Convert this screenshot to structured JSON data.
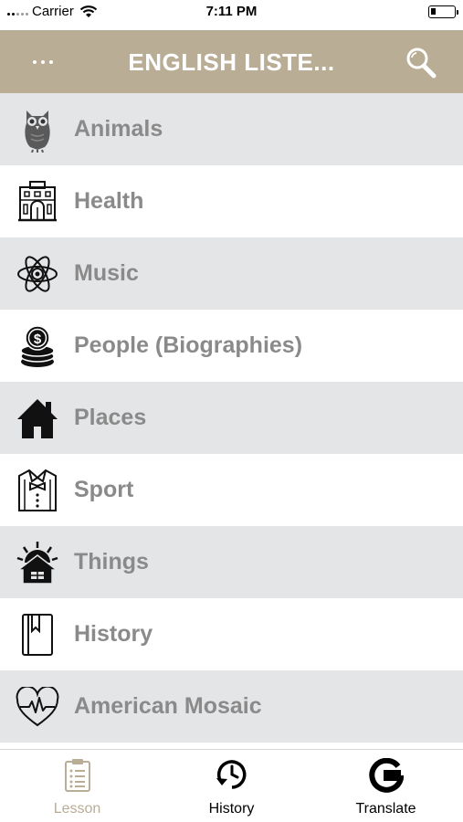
{
  "status_bar": {
    "carrier": "Carrier",
    "time": "7:11 PM"
  },
  "nav": {
    "title": "ENGLISH LISTE...",
    "menu_icon": "more-dots-icon",
    "search_icon": "search-icon",
    "background_color": "#b9ad95"
  },
  "categories": [
    {
      "label": "Animals",
      "icon": "owl-icon"
    },
    {
      "label": "Health",
      "icon": "building-icon"
    },
    {
      "label": "Music",
      "icon": "atom-icon"
    },
    {
      "label": "People (Biographies)",
      "icon": "coins-icon"
    },
    {
      "label": "Places",
      "icon": "house-icon"
    },
    {
      "label": "Sport",
      "icon": "shirt-bowtie-icon"
    },
    {
      "label": "Things",
      "icon": "sunrise-house-icon"
    },
    {
      "label": "History",
      "icon": "book-icon"
    },
    {
      "label": "American Mosaic",
      "icon": "heart-pulse-icon"
    }
  ],
  "tabs": [
    {
      "label": "Lesson",
      "icon": "clipboard-icon",
      "active": true
    },
    {
      "label": "History",
      "icon": "clock-history-icon",
      "active": false
    },
    {
      "label": "Translate",
      "icon": "google-g-icon",
      "active": false
    }
  ],
  "colors": {
    "accent": "#b9ad95",
    "row_alt": "#e4e5e7",
    "label_gray": "#8a8a8a"
  }
}
